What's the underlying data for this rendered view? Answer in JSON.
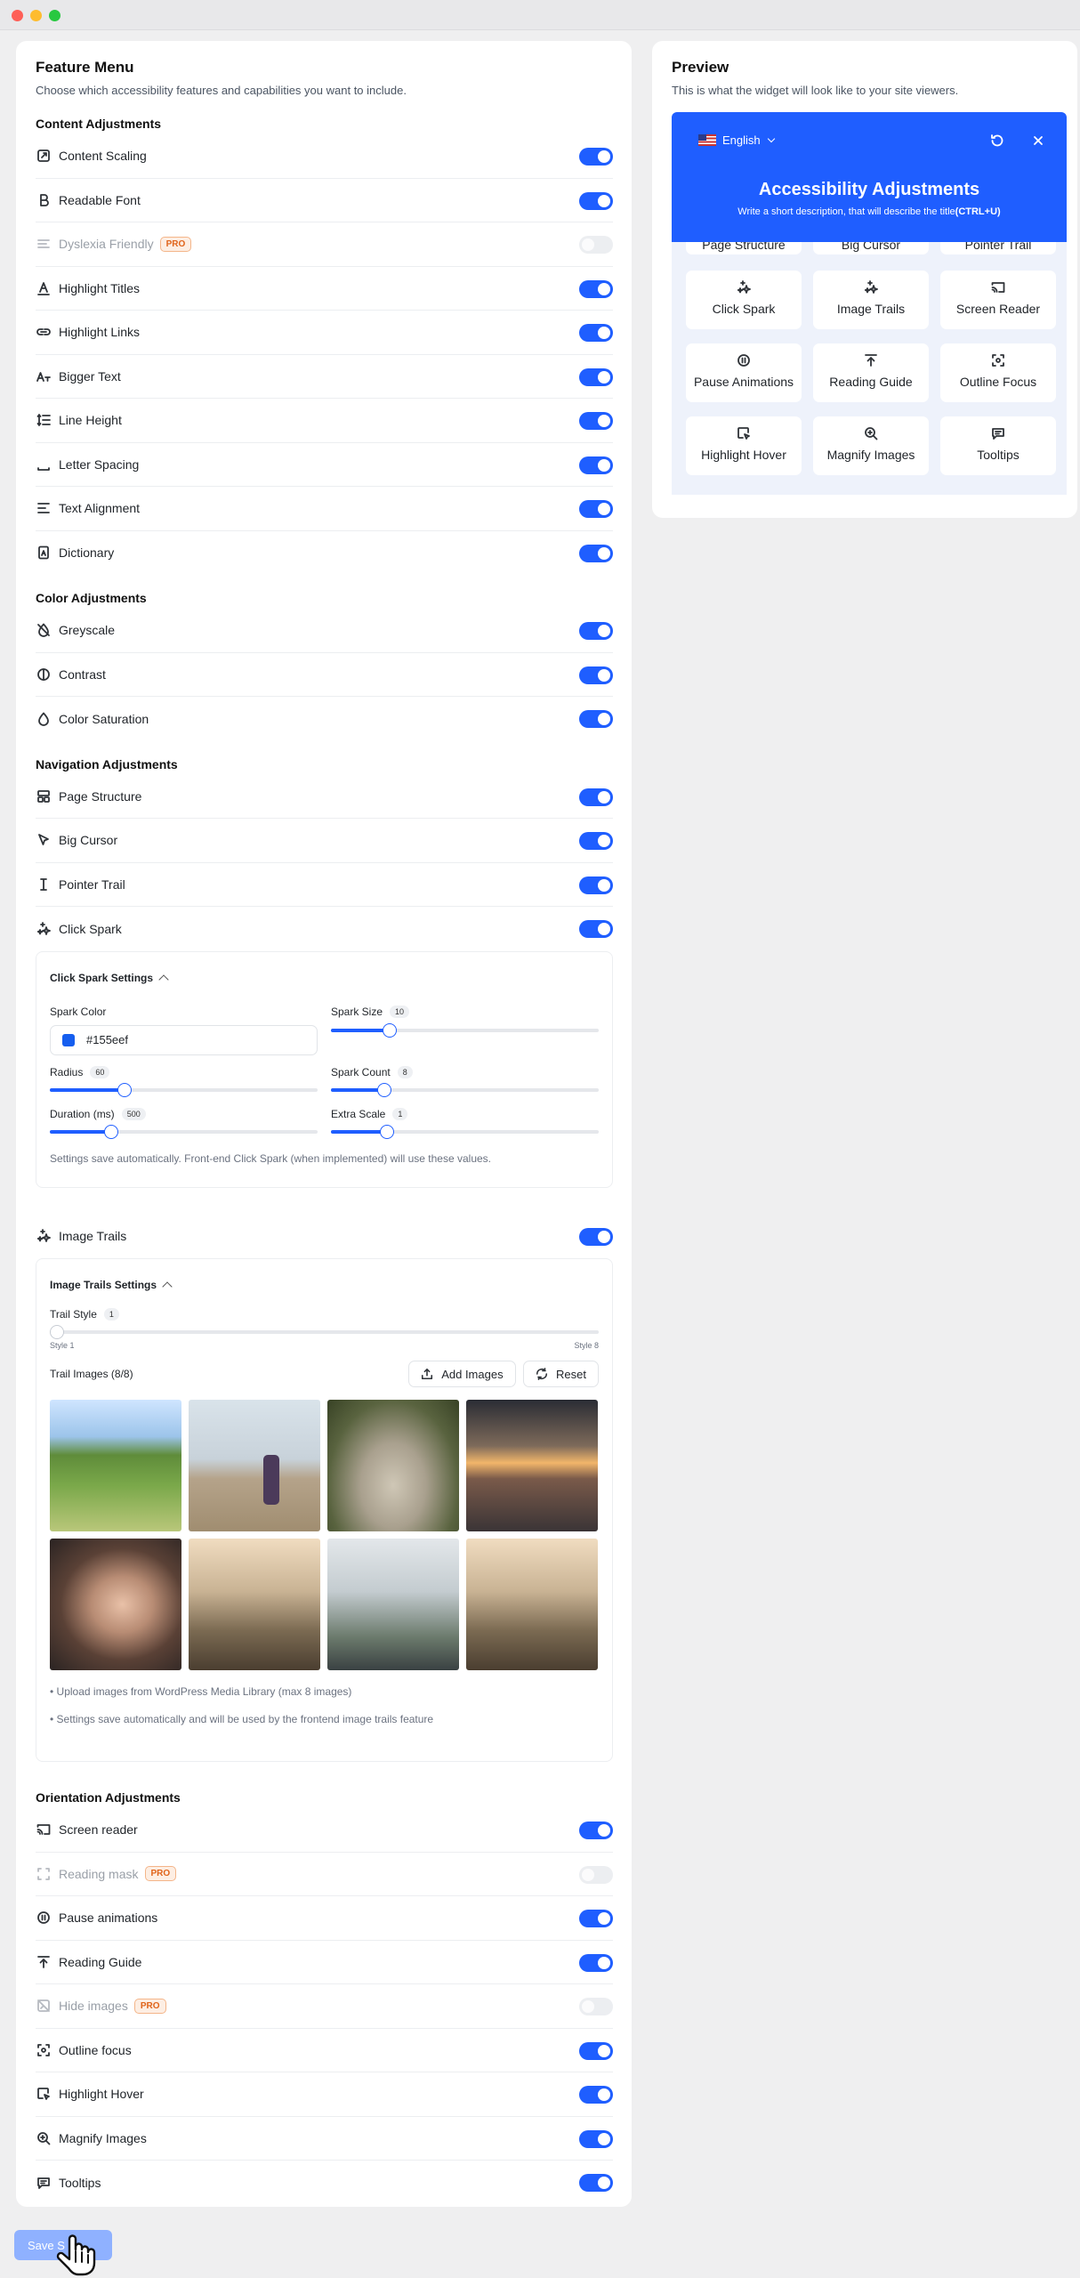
{
  "feature_menu": {
    "title": "Feature Menu",
    "subtitle": "Choose which accessibility features and capabilities you want to include.",
    "sections": [
      {
        "title": "Content Adjustments",
        "items": [
          {
            "label": "Content Scaling",
            "icon": "content-scaling-icon",
            "enabled": true
          },
          {
            "label": "Readable Font",
            "icon": "readable-font-icon",
            "enabled": true
          },
          {
            "label": "Dyslexia Friendly",
            "icon": "dyslexia-icon",
            "enabled": false,
            "pro": "PRO"
          },
          {
            "label": "Highlight Titles",
            "icon": "highlight-titles-icon",
            "enabled": true
          },
          {
            "label": "Highlight Links",
            "icon": "link-icon",
            "enabled": true
          },
          {
            "label": "Bigger Text",
            "icon": "bigger-text-icon",
            "enabled": true
          },
          {
            "label": "Line Height",
            "icon": "line-height-icon",
            "enabled": true
          },
          {
            "label": "Letter Spacing",
            "icon": "letter-spacing-icon",
            "enabled": true
          },
          {
            "label": "Text Alignment",
            "icon": "text-align-icon",
            "enabled": true
          },
          {
            "label": "Dictionary",
            "icon": "dictionary-icon",
            "enabled": true
          }
        ]
      },
      {
        "title": "Color Adjustments",
        "items": [
          {
            "label": "Greyscale",
            "icon": "greyscale-icon",
            "enabled": true
          },
          {
            "label": "Contrast",
            "icon": "contrast-icon",
            "enabled": true
          },
          {
            "label": "Color Saturation",
            "icon": "saturation-icon",
            "enabled": true
          }
        ]
      },
      {
        "title": "Navigation Adjustments",
        "items": [
          {
            "label": "Page Structure",
            "icon": "page-structure-icon",
            "enabled": true
          },
          {
            "label": "Big Cursor",
            "icon": "cursor-icon",
            "enabled": true
          },
          {
            "label": "Pointer Trail",
            "icon": "pointer-trail-icon",
            "enabled": true
          },
          {
            "label": "Click Spark",
            "icon": "sparkle-icon",
            "enabled": true
          }
        ]
      }
    ],
    "click_spark_settings": {
      "title": "Click Spark Settings",
      "spark_color_label": "Spark Color",
      "spark_color_value": "#155eef",
      "sliders": [
        {
          "label": "Spark Size",
          "value": "10",
          "fraction": 0.22
        },
        {
          "label": "Radius",
          "value": "60",
          "fraction": 0.28
        },
        {
          "label": "Spark Count",
          "value": "8",
          "fraction": 0.2
        },
        {
          "label": "Duration (ms)",
          "value": "500",
          "fraction": 0.23
        },
        {
          "label": "Extra Scale",
          "value": "1",
          "fraction": 0.21
        }
      ],
      "note": "Settings save automatically. Front-end Click Spark (when implemented) will use these values."
    },
    "image_trails": {
      "label": "Image Trails",
      "enabled": true,
      "settings_title": "Image Trails Settings",
      "trail_style_label": "Trail Style",
      "trail_style_value": "1",
      "trail_style_min": "Style 1",
      "trail_style_max": "Style 8",
      "trail_images_label": "Trail Images (8/8)",
      "add_images_label": "Add Images",
      "reset_label": "Reset",
      "note_1": "• Upload images from WordPress Media Library (max 8 images)",
      "note_2": "• Settings save automatically and will be used by the frontend image trails feature"
    },
    "orientation": {
      "title": "Orientation Adjustments",
      "items": [
        {
          "label": "Screen reader",
          "icon": "screen-reader-icon",
          "enabled": true
        },
        {
          "label": "Reading mask",
          "icon": "reading-mask-icon",
          "enabled": false,
          "pro": "PRO"
        },
        {
          "label": "Pause animations",
          "icon": "pause-icon",
          "enabled": true
        },
        {
          "label": "Reading Guide",
          "icon": "reading-guide-icon",
          "enabled": true
        },
        {
          "label": "Hide images",
          "icon": "hide-images-icon",
          "enabled": false,
          "pro": "PRO"
        },
        {
          "label": "Outline focus",
          "icon": "outline-focus-icon",
          "enabled": true
        },
        {
          "label": "Highlight Hover",
          "icon": "highlight-hover-icon",
          "enabled": true
        },
        {
          "label": "Magnify Images",
          "icon": "magnify-icon",
          "enabled": true
        },
        {
          "label": "Tooltips",
          "icon": "tooltip-icon",
          "enabled": true
        }
      ]
    }
  },
  "preview": {
    "title": "Preview",
    "subtitle": "This is what the widget will look like to your site viewers.",
    "language": "English",
    "widget_title": "Accessibility Adjustments",
    "widget_description": "Write a short description, that will describe the title",
    "widget_shortcut": "(CTRL+U)",
    "partial_cards": [
      "Page Structure",
      "Big Cursor",
      "Pointer Trail"
    ],
    "cards": [
      {
        "label": "Click Spark",
        "icon": "sparkle-icon"
      },
      {
        "label": "Image Trails",
        "icon": "sparkle-icon"
      },
      {
        "label": "Screen Reader",
        "icon": "screen-reader-icon"
      },
      {
        "label": "Pause Animations",
        "icon": "pause-icon"
      },
      {
        "label": "Reading Guide",
        "icon": "reading-guide-icon"
      },
      {
        "label": "Outline Focus",
        "icon": "outline-focus-icon"
      },
      {
        "label": "Highlight Hover",
        "icon": "highlight-hover-icon"
      },
      {
        "label": "Magnify Images",
        "icon": "magnify-icon"
      },
      {
        "label": "Tooltips",
        "icon": "tooltip-icon"
      }
    ]
  },
  "save_label": "Save S",
  "colors": {
    "accent": "#1f5eff",
    "pro": "#e0641a",
    "save": "#8fb1ff"
  }
}
